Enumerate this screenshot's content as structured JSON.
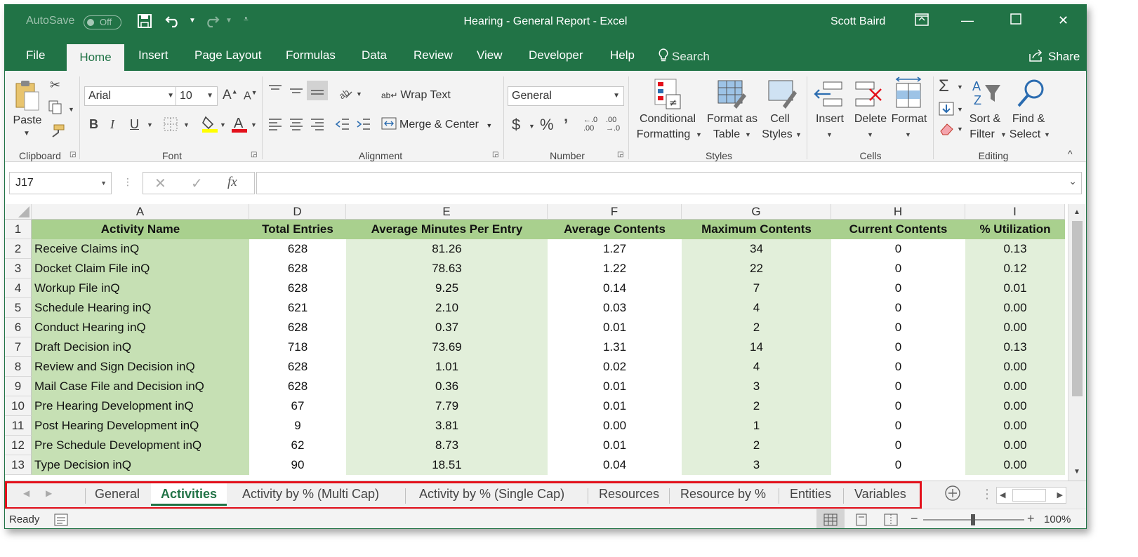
{
  "titlebar": {
    "autosave_label": "AutoSave",
    "autosave_state": "Off",
    "title": "Hearing - General Report  -  Excel",
    "user": "Scott Baird"
  },
  "ribbon_tabs": [
    "File",
    "Home",
    "Insert",
    "Page Layout",
    "Formulas",
    "Data",
    "Review",
    "View",
    "Developer",
    "Help"
  ],
  "search_label": "Search",
  "share_label": "Share",
  "ribbon": {
    "clipboard": {
      "paste": "Paste",
      "label": "Clipboard"
    },
    "font": {
      "name": "Arial",
      "size": "10",
      "bold": "B",
      "italic": "I",
      "underline": "U",
      "label": "Font"
    },
    "alignment": {
      "wrap": "Wrap Text",
      "merge": "Merge & Center",
      "label": "Alignment"
    },
    "number": {
      "format": "General",
      "currency": "$",
      "percent": "%",
      "comma": "’",
      "label": "Number"
    },
    "styles": {
      "conditional_1": "Conditional",
      "conditional_2": "Formatting",
      "format_table_1": "Format as",
      "format_table_2": "Table",
      "cell_styles_1": "Cell",
      "cell_styles_2": "Styles",
      "label": "Styles"
    },
    "cells": {
      "insert": "Insert",
      "delete": "Delete",
      "format": "Format",
      "label": "Cells"
    },
    "editing": {
      "sort_1": "Sort &",
      "sort_2": "Filter",
      "find_1": "Find &",
      "find_2": "Select",
      "label": "Editing"
    }
  },
  "formula": {
    "name_box": "J17",
    "fx": "fx",
    "value": ""
  },
  "columns": [
    {
      "letter": "A",
      "header": "Activity Name"
    },
    {
      "letter": "D",
      "header": "Total Entries"
    },
    {
      "letter": "E",
      "header": "Average Minutes Per Entry"
    },
    {
      "letter": "F",
      "header": "Average Contents"
    },
    {
      "letter": "G",
      "header": "Maximum Contents"
    },
    {
      "letter": "H",
      "header": "Current Contents"
    },
    {
      "letter": "I",
      "header": "% Utilization"
    }
  ],
  "row_numbers": [
    "1",
    "2",
    "3",
    "4",
    "5",
    "6",
    "7",
    "8",
    "9",
    "10",
    "11",
    "12",
    "13"
  ],
  "rows": [
    [
      "Receive Claims inQ",
      "628",
      "81.26",
      "1.27",
      "34",
      "0",
      "0.13"
    ],
    [
      "Docket Claim File inQ",
      "628",
      "78.63",
      "1.22",
      "22",
      "0",
      "0.12"
    ],
    [
      "Workup File inQ",
      "628",
      "9.25",
      "0.14",
      "7",
      "0",
      "0.01"
    ],
    [
      "Schedule Hearing inQ",
      "621",
      "2.10",
      "0.03",
      "4",
      "0",
      "0.00"
    ],
    [
      "Conduct Hearing inQ",
      "628",
      "0.37",
      "0.01",
      "2",
      "0",
      "0.00"
    ],
    [
      "Draft Decision inQ",
      "718",
      "73.69",
      "1.31",
      "14",
      "0",
      "0.13"
    ],
    [
      "Review and Sign Decision inQ",
      "628",
      "1.01",
      "0.02",
      "4",
      "0",
      "0.00"
    ],
    [
      "Mail Case File and Decision inQ",
      "628",
      "0.36",
      "0.01",
      "3",
      "0",
      "0.00"
    ],
    [
      "Pre Hearing Development inQ",
      "67",
      "7.79",
      "0.01",
      "2",
      "0",
      "0.00"
    ],
    [
      "Post Hearing Development inQ",
      "9",
      "3.81",
      "0.00",
      "1",
      "0",
      "0.00"
    ],
    [
      "Pre Schedule Development inQ",
      "62",
      "8.73",
      "0.01",
      "2",
      "0",
      "0.00"
    ],
    [
      "Type Decision inQ",
      "90",
      "18.51",
      "0.04",
      "3",
      "0",
      "0.00"
    ]
  ],
  "sheet_tabs": [
    "General",
    "Activities",
    "Activity by % (Multi Cap)",
    "Activity by % (Single Cap)",
    "Resources",
    "Resource by %",
    "Entities",
    "Variables"
  ],
  "active_sheet": "Activities",
  "status": {
    "ready": "Ready",
    "zoom": "100%"
  },
  "colors": {
    "accent": "#217346",
    "header_fill": "#a9d08e",
    "fill_dark": "#c6e0b4",
    "fill_light": "#e2efda",
    "highlight": "#e3101b"
  }
}
